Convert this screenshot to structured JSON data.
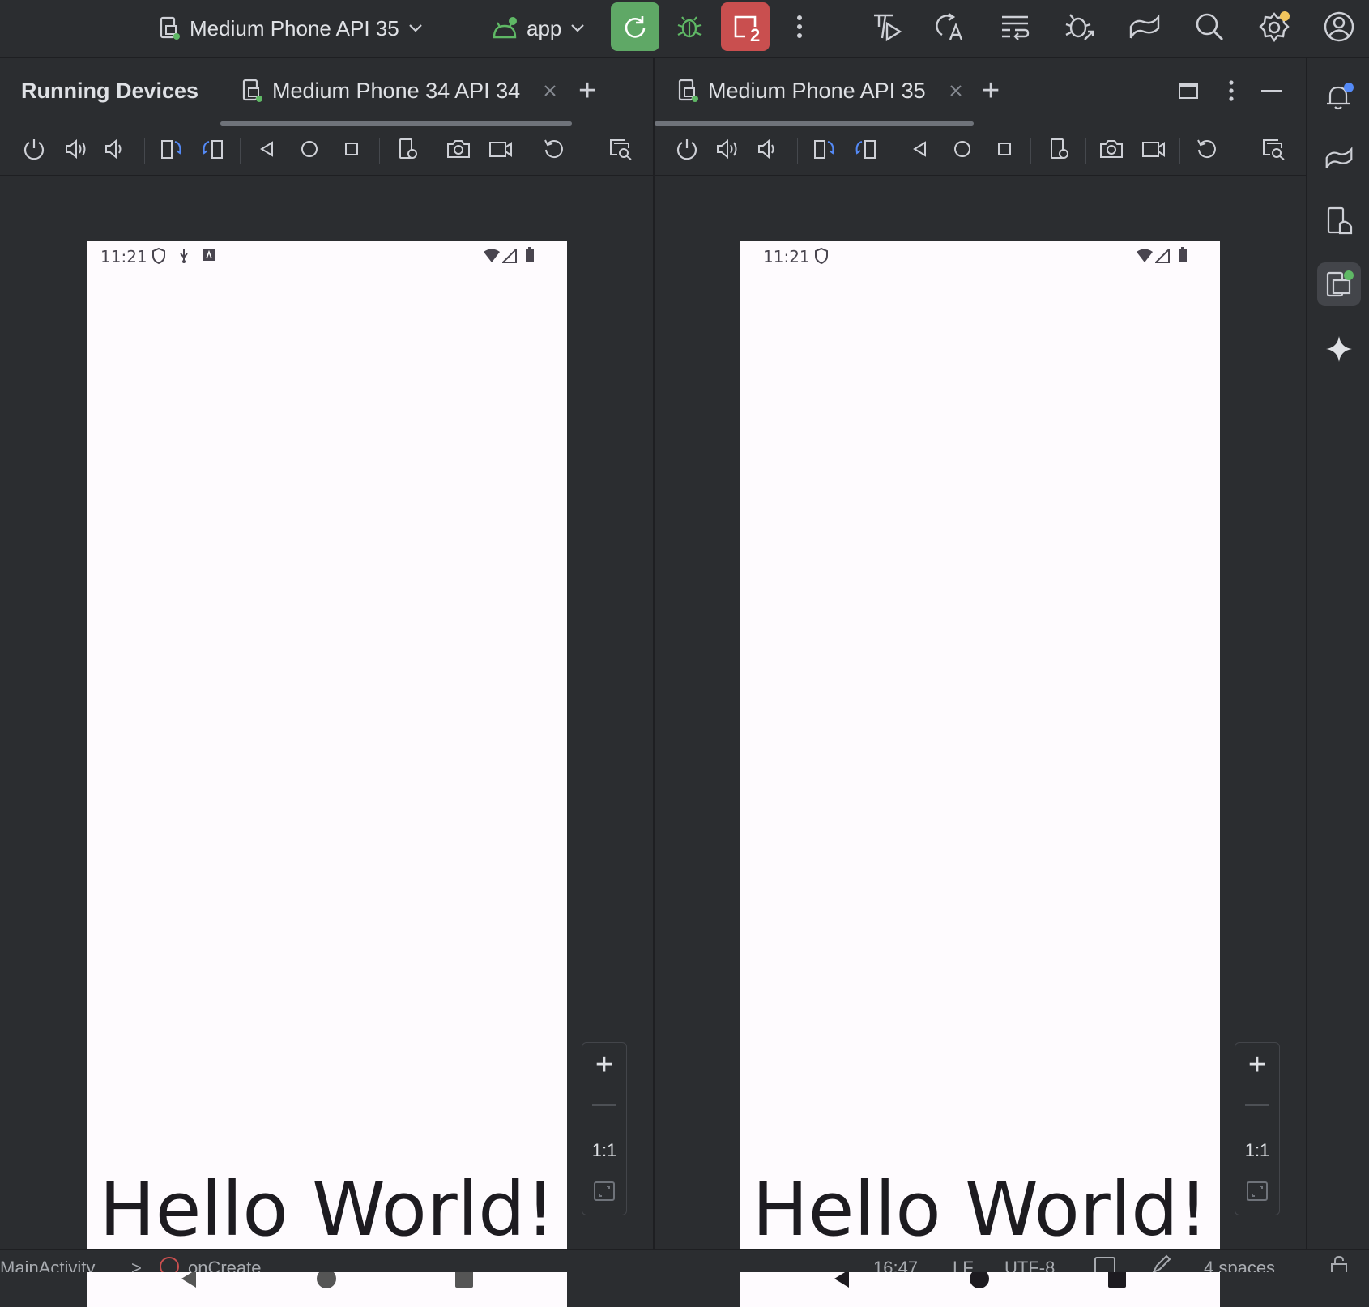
{
  "toolbar": {
    "device_selector": "Medium Phone API 35",
    "run_config": "app",
    "stop_badge": "2"
  },
  "running_devices": {
    "title": "Running Devices",
    "add_tab": "+",
    "panels": [
      {
        "tab_label": "Medium Phone 34 API 34",
        "status_time": "11:21",
        "screen_text": "Hello World!",
        "zoom_in": "+",
        "zoom_out": "—",
        "zoom_actual": "1:1"
      },
      {
        "tab_label": "Medium Phone API 35",
        "status_time": "11:21",
        "screen_text": "Hello World!",
        "zoom_in": "+",
        "zoom_out": "—",
        "zoom_actual": "1:1"
      }
    ]
  },
  "statusbar": {
    "breadcrumb_class": "MainActivity",
    "breadcrumb_sep": ">",
    "breadcrumb_method": "onCreate",
    "position": "16:47",
    "line_separator": "LF",
    "encoding": "UTF-8",
    "indent": "4 spaces"
  },
  "colors": {
    "accent_blue": "#548af7",
    "run_green": "#5fa866",
    "stop_red": "#c94f4f",
    "notification_dot": "#f2c55c"
  }
}
